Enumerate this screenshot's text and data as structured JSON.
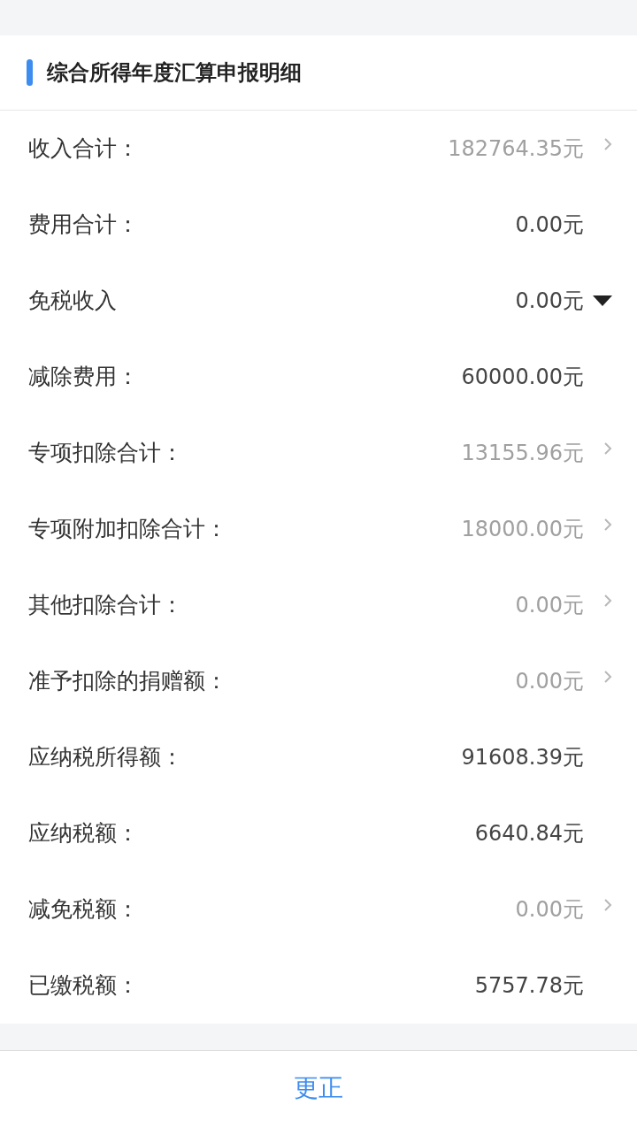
{
  "section": {
    "title": "综合所得年度汇算申报明细"
  },
  "rows": [
    {
      "label": "收入合计：",
      "value": "182764.35元",
      "kind": "link"
    },
    {
      "label": "费用合计：",
      "value": "0.00元",
      "kind": "plain"
    },
    {
      "label": "免税收入",
      "value": "0.00元",
      "kind": "dropdown"
    },
    {
      "label": "减除费用：",
      "value": "60000.00元",
      "kind": "plain"
    },
    {
      "label": "专项扣除合计：",
      "value": "13155.96元",
      "kind": "link"
    },
    {
      "label": "专项附加扣除合计：",
      "value": "18000.00元",
      "kind": "link"
    },
    {
      "label": "其他扣除合计：",
      "value": "0.00元",
      "kind": "link"
    },
    {
      "label": "准予扣除的捐赠额：",
      "value": "0.00元",
      "kind": "link"
    },
    {
      "label": "应纳税所得额：",
      "value": "91608.39元",
      "kind": "plain"
    },
    {
      "label": "应纳税额：",
      "value": "6640.84元",
      "kind": "plain"
    },
    {
      "label": "减免税额：",
      "value": "0.00元",
      "kind": "link"
    },
    {
      "label": "已缴税额：",
      "value": "5757.78元",
      "kind": "plain"
    }
  ],
  "footer": {
    "button": "更正"
  }
}
